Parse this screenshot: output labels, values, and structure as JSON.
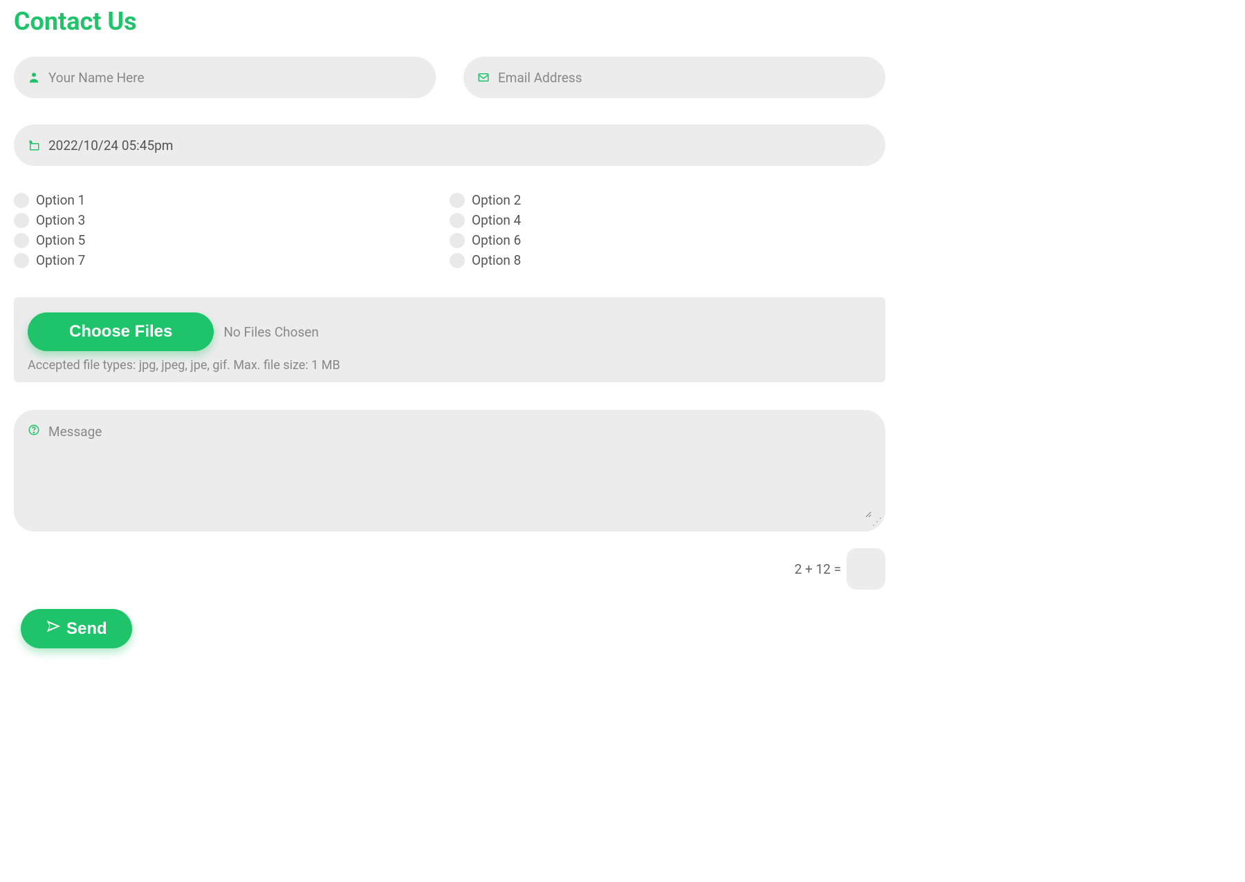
{
  "title": "Contact Us",
  "fields": {
    "name_placeholder": "Your Name Here",
    "email_placeholder": "Email Address",
    "datetime_value": "2022/10/24 05:45pm",
    "message_placeholder": "Message"
  },
  "options": [
    "Option 1",
    "Option 2",
    "Option 3",
    "Option 4",
    "Option 5",
    "Option 6",
    "Option 7",
    "Option 8"
  ],
  "upload": {
    "button_label": "Choose Files",
    "status": "No Files Chosen",
    "accepted": "Accepted file types: jpg, jpeg, jpe, gif. Max. file size: 1 MB"
  },
  "captcha": {
    "label": "2 + 12 ="
  },
  "submit": {
    "label": "Send"
  },
  "colors": {
    "accent": "#1fc46a",
    "field_bg": "#ececec"
  }
}
